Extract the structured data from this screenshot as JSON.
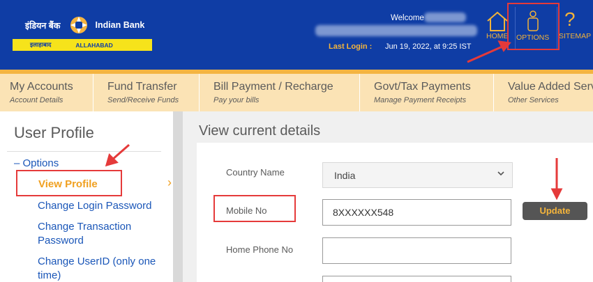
{
  "header": {
    "brand_hindi": "इंडियन बैंक",
    "brand_english": "Indian Bank",
    "bar_left": "इलाहाबाद",
    "bar_right": "ALLAHABAD",
    "welcome_label": "Welcome",
    "last_login_label": "Last Login :",
    "last_login_value": "Jun 19, 2022, at 9:25 IST",
    "home_label": "HOME",
    "options_label": "OPTIONS",
    "sitemap_label": "SITEMAP",
    "sitemap_glyph": "?",
    "accent_color": "#f0b23a",
    "header_color": "#0f3da5"
  },
  "nav": {
    "items": [
      {
        "title": "My Accounts",
        "sub": "Account Details"
      },
      {
        "title": "Fund Transfer",
        "sub": "Send/Receive Funds"
      },
      {
        "title": "Bill Payment / Recharge",
        "sub": "Pay your bills"
      },
      {
        "title": "Govt/Tax Payments",
        "sub": "Manage Payment Receipts"
      },
      {
        "title": "Value Added Serv",
        "sub": "Other Services"
      }
    ]
  },
  "sidebar": {
    "title": "User Profile",
    "options_label": "Options",
    "collapse_glyph": "–",
    "active_item": "View Profile",
    "items": [
      {
        "label": "Change Login Password"
      },
      {
        "label": "Change Transaction Password"
      },
      {
        "label": "Change UserID (only one time)"
      }
    ],
    "chevron": "›"
  },
  "main": {
    "title": "View current details",
    "fields": {
      "country_label": "Country Name",
      "country_value": "India",
      "mobile_label": "Mobile No",
      "mobile_value": "8XXXXXX548",
      "home_phone_label": "Home Phone No",
      "home_phone_value": ""
    },
    "update_label": "Update"
  }
}
